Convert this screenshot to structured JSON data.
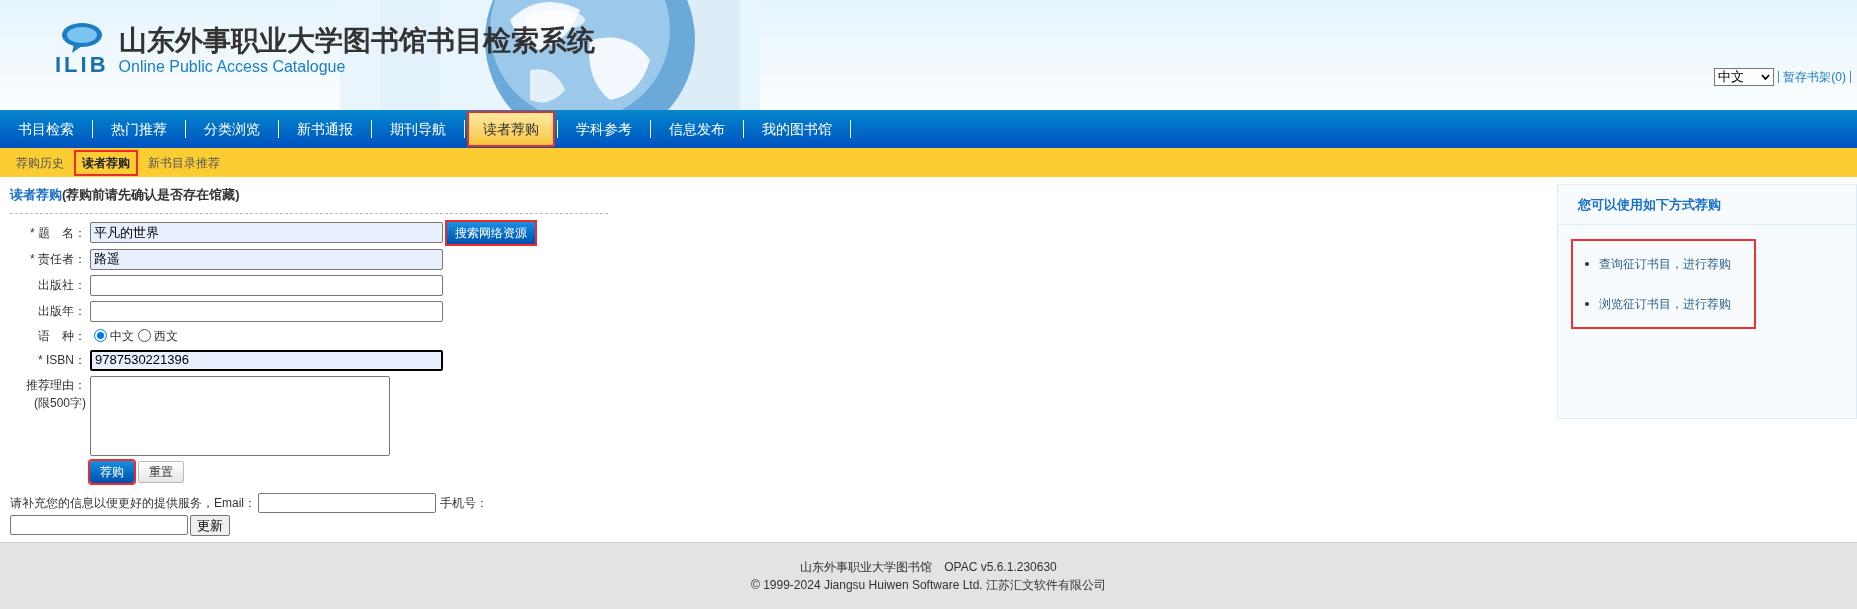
{
  "header": {
    "logo_text": "ILIB",
    "title": "山东外事职业大学图书馆书目检索系统",
    "subtitle": "Online Public Access Catalogue",
    "language": "中文",
    "cart_link": "暂存书架(0)"
  },
  "nav": [
    {
      "label": "书目检索",
      "selected": false,
      "highlighted": false
    },
    {
      "label": "热门推荐",
      "selected": false,
      "highlighted": false
    },
    {
      "label": "分类浏览",
      "selected": false,
      "highlighted": false
    },
    {
      "label": "新书通报",
      "selected": false,
      "highlighted": false
    },
    {
      "label": "期刊导航",
      "selected": false,
      "highlighted": false
    },
    {
      "label": "读者荐购",
      "selected": true,
      "highlighted": true
    },
    {
      "label": "学科参考",
      "selected": false,
      "highlighted": false
    },
    {
      "label": "信息发布",
      "selected": false,
      "highlighted": false
    },
    {
      "label": "我的图书馆",
      "selected": false,
      "highlighted": false
    }
  ],
  "subnav": [
    {
      "label": "荐购历史",
      "selected": false,
      "highlighted": false
    },
    {
      "label": "读者荐购",
      "selected": true,
      "highlighted": true
    },
    {
      "label": "新书目录推荐",
      "selected": false,
      "highlighted": false
    }
  ],
  "form": {
    "title": "读者荐购",
    "title_note": "(荐购前请先确认是否存在馆藏)",
    "fields": [
      {
        "kind": "text",
        "label": "* 题　名：",
        "value": "平凡的世界",
        "autofilled": true,
        "focused": false,
        "button": {
          "label": "搜索网络资源",
          "highlighted": true
        }
      },
      {
        "kind": "text",
        "label": "* 责任者：",
        "value": "路遥",
        "autofilled": true,
        "focused": false
      },
      {
        "kind": "text",
        "label": "出版社：",
        "autofilled": false,
        "focused": false
      },
      {
        "kind": "text",
        "label": "出版年：",
        "autofilled": false,
        "focused": false
      },
      {
        "kind": "radio",
        "label": "语　种：",
        "options": [
          {
            "label": "中文",
            "selected": true
          },
          {
            "label": "西文",
            "selected": false
          }
        ]
      },
      {
        "kind": "text",
        "label": "* ISBN：",
        "value": "9787530221396",
        "autofilled": true,
        "focused": true
      },
      {
        "kind": "textarea",
        "label": "推荐理由：",
        "note": "(限500字)"
      }
    ],
    "buttons": [
      {
        "label": "荐购",
        "kind": "primary",
        "highlighted": true
      },
      {
        "label": "重置",
        "kind": "plain",
        "highlighted": false
      }
    ],
    "contact": {
      "text": "请补充您的信息以便更好的提供服务，Email：",
      "phone_label": "手机号：",
      "button": "更新"
    }
  },
  "side_panel": {
    "title": "您可以使用如下方式荐购",
    "highlighted": true,
    "links": [
      "查询征订书目，进行荐购",
      "浏览征订书目，进行荐购"
    ]
  },
  "footer": {
    "line_1": "山东外事职业大学图书馆　OPAC v5.6.1.230630",
    "line_2": "© 1999-2024 Jiangsu Huiwen Software Ltd. 江苏汇文软件有限公司"
  }
}
